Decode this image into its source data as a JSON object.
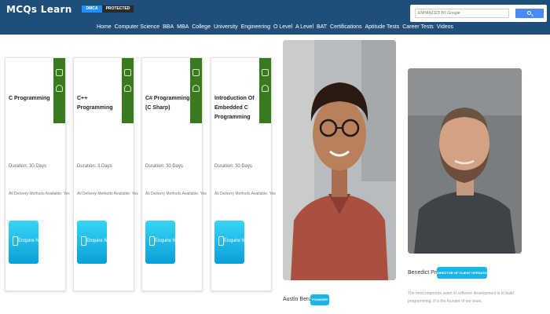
{
  "header": {
    "logo": "MCQs Learn",
    "badges": {
      "dmca": "DMCA",
      "protected": "PROTECTED"
    },
    "search": {
      "placeholder": "ENHANCED BY Google"
    },
    "nav": [
      "Home",
      "Computer Science",
      "BBA",
      "MBA",
      "College",
      "University",
      "Engineering",
      "O Level",
      "A Level",
      "BAT",
      "Certifications",
      "Aptitude Tests",
      "Career Tests",
      "Videos"
    ]
  },
  "courses": [
    {
      "title": "C Programming",
      "duration": "Duration: 30 Days",
      "delivery": "All Delivery Methods Available: Yes",
      "button": "Enquire Now"
    },
    {
      "title": "C++ Programming",
      "duration": "Duration: 3 Days",
      "delivery": "All Delivery Methods Available: Yes",
      "button": "Enquire Now"
    },
    {
      "title": "C# Programming (C Sharp)",
      "duration": "Duration: 30 Days",
      "delivery": "All Delivery Methods Available: Yes",
      "button": "Enquire Now"
    },
    {
      "title": "Introduction Of Embedded C Programming",
      "duration": "Duration: 30 Days",
      "delivery": "All Delivery Methods Available: Yes",
      "button": "Enquire Now"
    }
  ],
  "instructors": [
    {
      "name": "Austin Benzer",
      "role": "FOUNDER"
    },
    {
      "name": "Benedict Price",
      "role": "DIRECTOR OF CLIENT OPERATIONS",
      "bio": "The most important asset of software development is to build programming. It is the founder of our team."
    }
  ],
  "colors": {
    "header": "#1f4e79",
    "card_tag": "#3a7a1e",
    "accent": "#19b5e6"
  }
}
